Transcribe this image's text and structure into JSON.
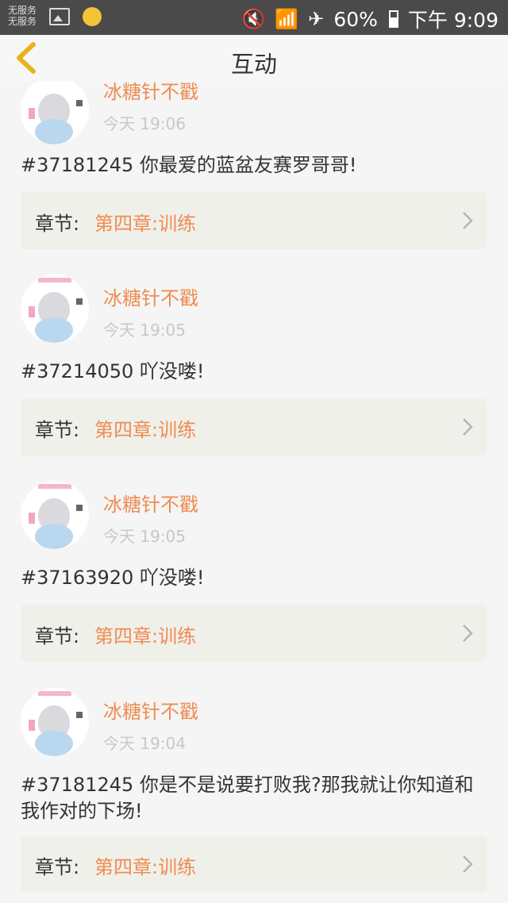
{
  "status_bar": {
    "carrier_line1": "无服务",
    "carrier_line2": "无服务",
    "battery": "60%",
    "time": "下午 9:09"
  },
  "header": {
    "title": "互动"
  },
  "posts": [
    {
      "username": "冰糖针不戳",
      "time": "今天 19:06",
      "content": "#37181245 你最爱的蓝盆友赛罗哥哥!",
      "chapter_label": "章节:",
      "chapter_value": "第四章:训练"
    },
    {
      "username": "冰糖针不戳",
      "time": "今天 19:05",
      "content": "#37214050 吖没喽!",
      "chapter_label": "章节:",
      "chapter_value": "第四章:训练"
    },
    {
      "username": "冰糖针不戳",
      "time": "今天 19:05",
      "content": "#37163920 吖没喽!",
      "chapter_label": "章节:",
      "chapter_value": "第四章:训练"
    },
    {
      "username": "冰糖针不戳",
      "time": "今天 19:04",
      "content": "#37181245 你是不是说要打败我?那我就让你知道和我作对的下场!",
      "chapter_label": "章节:",
      "chapter_value": "第四章:训练"
    }
  ],
  "colors": {
    "accent": "#ef8c52",
    "back_arrow": "#e9b21b",
    "chapter_bg": "#f0f0ea"
  }
}
